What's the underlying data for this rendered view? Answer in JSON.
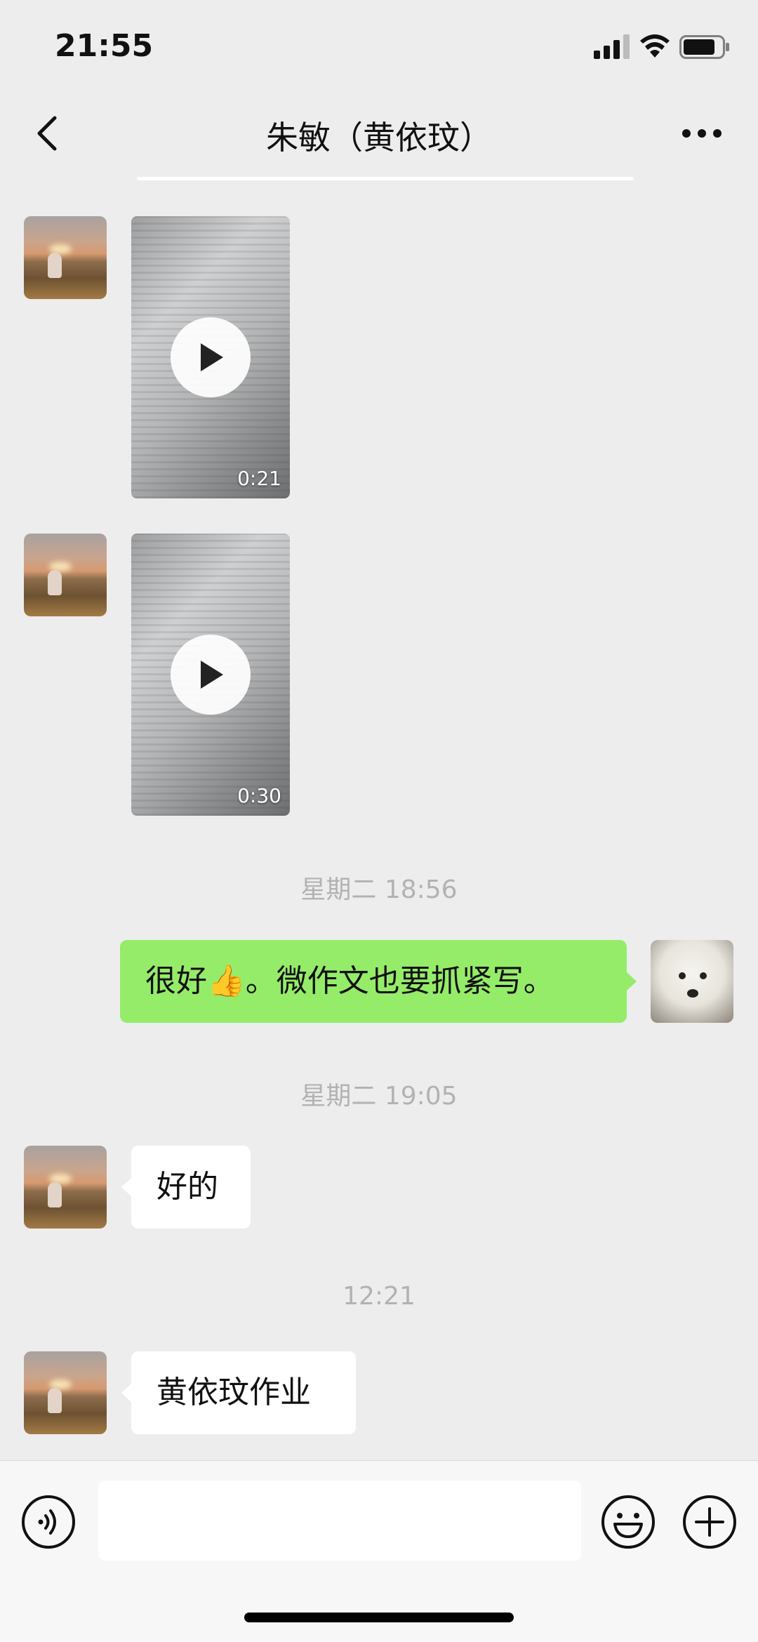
{
  "status_bar": {
    "time": "21:55",
    "signal_icon": "cellular-signal-icon",
    "wifi_icon": "wifi-icon",
    "battery_icon": "battery-icon"
  },
  "nav": {
    "title": "朱敏（黄依玟）",
    "back_icon": "chevron-left-icon",
    "more_icon": "more-dots-icon"
  },
  "messages": [
    {
      "type": "video",
      "side": "left",
      "duration": "0:21"
    },
    {
      "type": "video",
      "side": "left",
      "duration": "0:30"
    },
    {
      "type": "timestamp",
      "text": "星期二 18:56"
    },
    {
      "type": "text",
      "side": "right",
      "text": "很好👍。微作文也要抓紧写。"
    },
    {
      "type": "timestamp",
      "text": "星期二 19:05"
    },
    {
      "type": "text",
      "side": "left",
      "text": "好的"
    },
    {
      "type": "timestamp",
      "text": "12:21"
    },
    {
      "type": "text",
      "side": "left",
      "text": "黄依玟作业"
    }
  ],
  "input_bar": {
    "voice_icon": "voice-input-icon",
    "text_value": "",
    "emoji_icon": "emoji-icon",
    "plus_icon": "plus-circle-icon"
  },
  "colors": {
    "background": "#ededed",
    "outgoing_bubble": "#95ec69",
    "incoming_bubble": "#ffffff",
    "timestamp_text": "#b2b2b2"
  }
}
